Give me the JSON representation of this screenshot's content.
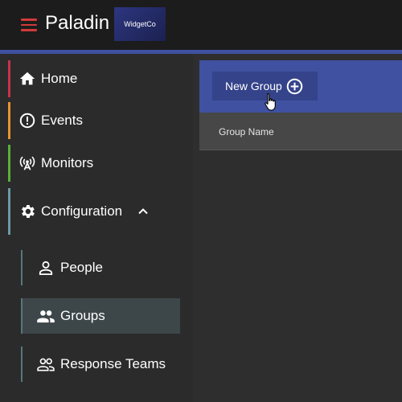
{
  "header": {
    "app_name": "Paladin",
    "org_badge": "WidgetCo",
    "colors": {
      "accent": "#3f51a0",
      "menu_icon": "#d23a3a",
      "topbar": "#1c1c1c"
    }
  },
  "sidebar": {
    "items": [
      {
        "label": "Home",
        "icon": "home-icon",
        "color": "#c6334a"
      },
      {
        "label": "Events",
        "icon": "alert-circle-icon",
        "color": "#e6942e"
      },
      {
        "label": "Monitors",
        "icon": "broadcast-icon",
        "color": "#57b03a"
      },
      {
        "label": "Configuration",
        "icon": "gear-icon",
        "color": "#6e98a6",
        "expanded": true
      }
    ],
    "subitems": [
      {
        "label": "People",
        "icon": "person-icon"
      },
      {
        "label": "Groups",
        "icon": "people-icon",
        "active": true
      },
      {
        "label": "Response Teams",
        "icon": "people-outline-icon"
      }
    ]
  },
  "main": {
    "new_group_label": "New Group",
    "table": {
      "columns": [
        "Group Name"
      ]
    }
  }
}
